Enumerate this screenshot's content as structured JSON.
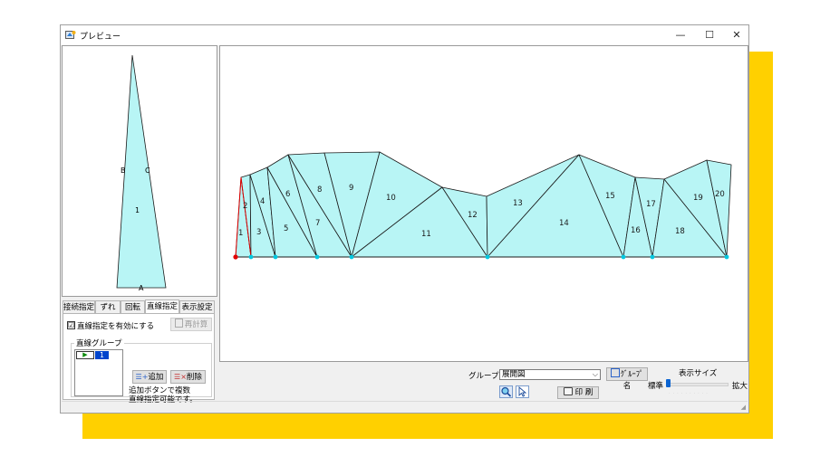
{
  "window": {
    "title": "プレビュー",
    "minimize": "—",
    "maximize": "☐",
    "close": "✕"
  },
  "preview": {
    "small_labels": [
      "B",
      "C",
      "1",
      "A"
    ],
    "triangle_labels": [
      "1",
      "2",
      "3",
      "4",
      "5",
      "6",
      "7",
      "8",
      "9",
      "10",
      "11",
      "12",
      "13",
      "14",
      "15",
      "16",
      "17",
      "18",
      "19",
      "20"
    ]
  },
  "tabs": [
    "接続指定",
    "ずれ",
    "回転",
    "直線指定",
    "表示設定"
  ],
  "active_tab": "直線指定",
  "straight_panel": {
    "enable_checkbox_label": "直線指定を有効にする",
    "enable_checked": "☑",
    "recalc_button": "再計算",
    "group_legend": "直線グループ",
    "list_value": "1",
    "add_button": "追加",
    "delete_button": "削除",
    "note_line1": "追加ボタンで複数",
    "note_line2": "直線指定可能です。"
  },
  "footer": {
    "group_label": "グループ",
    "group_value": "展開図",
    "group_name_button": "ｸﾞﾙｰﾌﾟ名",
    "display_size_label": "表示サイズ",
    "standard_label": "標準",
    "enlarge_label": "拡大",
    "print_button": "印 刷"
  },
  "colors": {
    "fill": "#b8f5f5",
    "line": "#1a1a1a",
    "selected_line": "#e00000",
    "vertex": "#00c8e0",
    "start_vertex": "#e00000",
    "accent": "#ffd000"
  }
}
